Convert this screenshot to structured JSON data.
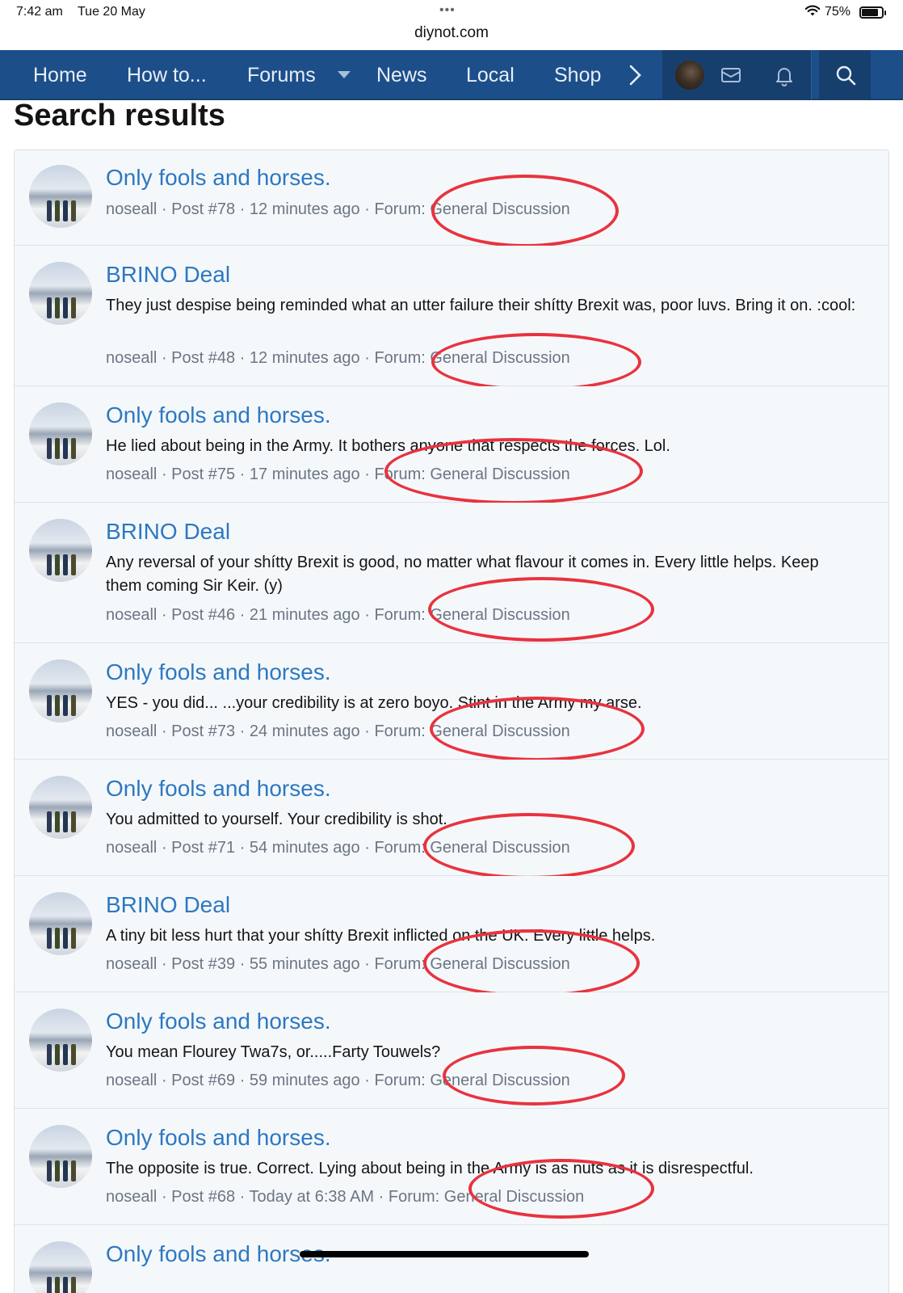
{
  "status": {
    "time": "7:42 am",
    "date": "Tue 20 May",
    "dots": "•••",
    "url": "diynot.com",
    "battery": "75%"
  },
  "nav": {
    "items": [
      "Home",
      "How to...",
      "Forums",
      "News",
      "Local",
      "Shop"
    ],
    "more": "›"
  },
  "page_title": "Search results",
  "results": [
    {
      "title": "Only fools and horses.",
      "snippet": "",
      "author": "noseall",
      "post": "Post #78",
      "time": "12 minutes ago",
      "forum_label": "Forum:",
      "forum": "General Discussion"
    },
    {
      "title": "BRINO Deal",
      "snippet": "They just despise being reminded what an utter failure their shítty Brexit was, poor luvs. Bring it on. :cool:",
      "author": "noseall",
      "post": "Post #48",
      "time": "12 minutes ago",
      "forum_label": "Forum:",
      "forum": "General Discussion"
    },
    {
      "title": "Only fools and horses.",
      "snippet": "He lied about being in the Army. It bothers anyone that respects the forces. Lol.",
      "author": "noseall",
      "post": "Post #75",
      "time": "17 minutes ago",
      "forum_label": "Forum:",
      "forum": "General Discussion"
    },
    {
      "title": "BRINO Deal",
      "snippet": "Any reversal of your shítty Brexit is good, no matter what flavour it comes in. Every little helps. Keep them coming Sir Keir. (y)",
      "author": "noseall",
      "post": "Post #46",
      "time": "21 minutes ago",
      "forum_label": "Forum:",
      "forum": "General Discussion"
    },
    {
      "title": "Only fools and horses.",
      "snippet": "YES - you did... ...your credibility is at zero boyo. Stint in the Army my arse.",
      "author": "noseall",
      "post": "Post #73",
      "time": "24 minutes ago",
      "forum_label": "Forum:",
      "forum": "General Discussion"
    },
    {
      "title": "Only fools and horses.",
      "snippet": "You admitted to yourself. Your credibility is shot.",
      "author": "noseall",
      "post": "Post #71",
      "time": "54 minutes ago",
      "forum_label": "Forum:",
      "forum": "General Discussion"
    },
    {
      "title": "BRINO Deal",
      "snippet": "A tiny bit less hurt that your shítty Brexit inflicted on the UK. Every little helps.",
      "author": "noseall",
      "post": "Post #39",
      "time": "55 minutes ago",
      "forum_label": "Forum:",
      "forum": "General Discussion"
    },
    {
      "title": "Only fools and horses.",
      "snippet": "You mean Flourey Twa7s, or.....Farty Touwels?",
      "author": "noseall",
      "post": "Post #69",
      "time": "59 minutes ago",
      "forum_label": "Forum:",
      "forum": "General Discussion"
    },
    {
      "title": "Only fools and horses.",
      "snippet": "The opposite is true. Correct. Lying about being in the Army is as nuts as it is disrespectful.",
      "author": "noseall",
      "post": "Post #68",
      "time": "Today at 6:38 AM",
      "forum_label": "Forum:",
      "forum": "General Discussion"
    },
    {
      "title": "Only fools and horses.",
      "snippet": "",
      "author": "",
      "post": "",
      "time": "",
      "forum_label": "",
      "forum": ""
    }
  ],
  "colors": {
    "nav_bg": "#1c4f8a",
    "link": "#2d78c2",
    "annotation": "#e8333f"
  }
}
